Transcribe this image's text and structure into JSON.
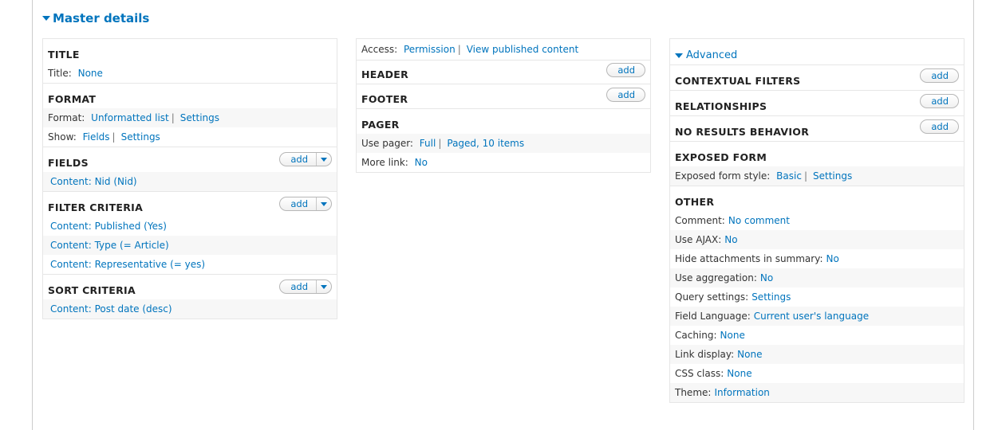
{
  "master_label": "Master details",
  "add_label": "add",
  "sep": "|",
  "col1": {
    "title": {
      "heading": "TITLE",
      "rows": [
        {
          "label": "Title:",
          "value": "None"
        }
      ]
    },
    "format": {
      "heading": "FORMAT",
      "format_label": "Format:",
      "format_value": "Unformatted list",
      "format_settings": "Settings",
      "show_label": "Show:",
      "show_value": "Fields",
      "show_settings": "Settings"
    },
    "fields": {
      "heading": "FIELDS",
      "items": [
        "Content: Nid (Nid)"
      ]
    },
    "filter": {
      "heading": "FILTER CRITERIA",
      "items": [
        "Content: Published (Yes)",
        "Content: Type (= Article)",
        "Content: Representative (= yes)"
      ]
    },
    "sort": {
      "heading": "SORT CRITERIA",
      "items": [
        "Content: Post date (desc)"
      ]
    }
  },
  "col2": {
    "access_label": "Access:",
    "access_value": "Permission",
    "access_detail": "View published content",
    "header": "HEADER",
    "footer": "FOOTER",
    "pager": {
      "heading": "PAGER",
      "use_label": "Use pager:",
      "use_value": "Full",
      "use_detail": "Paged, 10 items",
      "more_label": "More link:",
      "more_value": "No"
    }
  },
  "col3": {
    "advanced_label": "Advanced",
    "contextual": "CONTEXTUAL FILTERS",
    "relationships": "RELATIONSHIPS",
    "no_results": "NO RESULTS BEHAVIOR",
    "exposed": {
      "heading": "EXPOSED FORM",
      "label": "Exposed form style:",
      "value": "Basic",
      "settings": "Settings"
    },
    "other": {
      "heading": "OTHER",
      "rows": [
        {
          "label": "Comment:",
          "value": "No comment"
        },
        {
          "label": "Use AJAX:",
          "value": "No"
        },
        {
          "label": "Hide attachments in summary:",
          "value": "No"
        },
        {
          "label": "Use aggregation:",
          "value": "No"
        },
        {
          "label": "Query settings:",
          "value": "Settings"
        },
        {
          "label": "Field Language:",
          "value": "Current user's language"
        },
        {
          "label": "Caching:",
          "value": "None"
        },
        {
          "label": "Link display:",
          "value": "None"
        },
        {
          "label": "CSS class:",
          "value": "None"
        },
        {
          "label": "Theme:",
          "value": "Information"
        }
      ]
    }
  }
}
